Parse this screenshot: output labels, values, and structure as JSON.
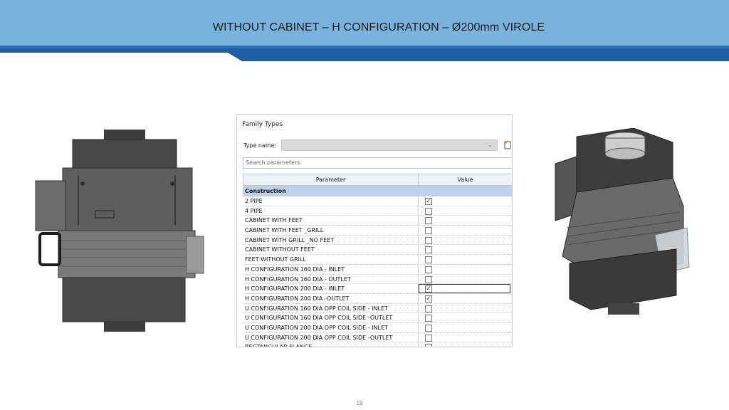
{
  "header": {
    "title": "WITHOUT CABINET – H CONFIGURATION – Ø200mm VIROLE"
  },
  "dialog": {
    "title": "Family Types",
    "type_name_label": "Type name:",
    "search_placeholder": "Search parameters",
    "columns": {
      "parameter": "Parameter",
      "value": "Value"
    },
    "section": "Construction",
    "rows": [
      {
        "label": "2 PIPE",
        "checked": true
      },
      {
        "label": "4 PIPE",
        "checked": false
      },
      {
        "label": "CABINET WITH FEET",
        "checked": false
      },
      {
        "label": "CABINET WITH FEET _GRILL",
        "checked": false
      },
      {
        "label": "CABINET WITH GRILL _NO FEET",
        "checked": false
      },
      {
        "label": "CABINET WITHOUT FEET",
        "checked": false
      },
      {
        "label": "FEET WITHOUT GRILL",
        "checked": false
      },
      {
        "label": "H CONFIGURATION 160 DIA - INLET",
        "checked": false
      },
      {
        "label": "H CONFIGURATION 160 DIA - OUTLET",
        "checked": false
      },
      {
        "label": "H CONFIGURATION 200 DIA - INLET",
        "checked": true
      },
      {
        "label": "H CONFIGURATION 200 DIA -OUTLET",
        "checked": true
      },
      {
        "label": "U CONFIGURATION 160 DIA OPP  COIL SIDE - INLET",
        "checked": false
      },
      {
        "label": "U CONFIGURATION 160 DIA OPP  COIL SIDE -OUTLET",
        "checked": false
      },
      {
        "label": "U CONFIGURATION 200 DIA OPP COIL SIDE - INLET",
        "checked": false
      },
      {
        "label": "U CONFIGURATION 200 DIA OPP COIL SIDE -OUTLET",
        "checked": false
      },
      {
        "label": "RECTANGULAR FLANGE",
        "checked": false
      }
    ],
    "equals_sign": "="
  },
  "footer": {
    "page_number": "19"
  },
  "colors": {
    "header": "#77b3dd",
    "stripe_dark": "#1f5fa6",
    "section": "#bfd1e9"
  }
}
